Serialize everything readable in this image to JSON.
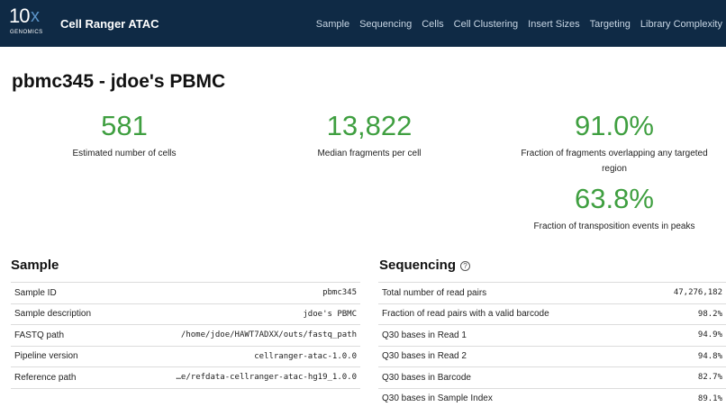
{
  "header": {
    "logo_main": "10",
    "logo_x": "x",
    "logo_sub": "GENOMICS",
    "app_title": "Cell Ranger ATAC",
    "nav": [
      "Sample",
      "Sequencing",
      "Cells",
      "Cell Clustering",
      "Insert Sizes",
      "Targeting",
      "Library Complexity"
    ]
  },
  "page_title": "pbmc345 - jdoe's PBMC",
  "metrics": [
    {
      "value": "581",
      "label": "Estimated number of cells"
    },
    {
      "value": "13,822",
      "label": "Median fragments per cell"
    },
    {
      "value": "91.0%",
      "label": "Fraction of fragments overlapping any targeted region"
    },
    {
      "value": "63.8%",
      "label": "Fraction of transposition events in peaks"
    }
  ],
  "sample": {
    "title": "Sample",
    "rows": [
      {
        "key": "Sample ID",
        "value": "pbmc345"
      },
      {
        "key": "Sample description",
        "value": "jdoe's PBMC"
      },
      {
        "key": "FASTQ path",
        "value": "/home/jdoe/HAWT7ADXX/outs/fastq_path"
      },
      {
        "key": "Pipeline version",
        "value": "cellranger-atac-1.0.0"
      },
      {
        "key": "Reference path",
        "value": "…e/refdata-cellranger-atac-hg19_1.0.0"
      }
    ]
  },
  "sequencing": {
    "title": "Sequencing",
    "help_icon": "?",
    "rows": [
      {
        "key": "Total number of read pairs",
        "value": "47,276,182"
      },
      {
        "key": "Fraction of read pairs with a valid barcode",
        "value": "98.2%"
      },
      {
        "key": "Q30 bases in Read 1",
        "value": "94.9%"
      },
      {
        "key": "Q30 bases in Read 2",
        "value": "94.8%"
      },
      {
        "key": "Q30 bases in Barcode",
        "value": "82.7%"
      },
      {
        "key": "Q30 bases in Sample Index",
        "value": "89.1%"
      }
    ]
  }
}
